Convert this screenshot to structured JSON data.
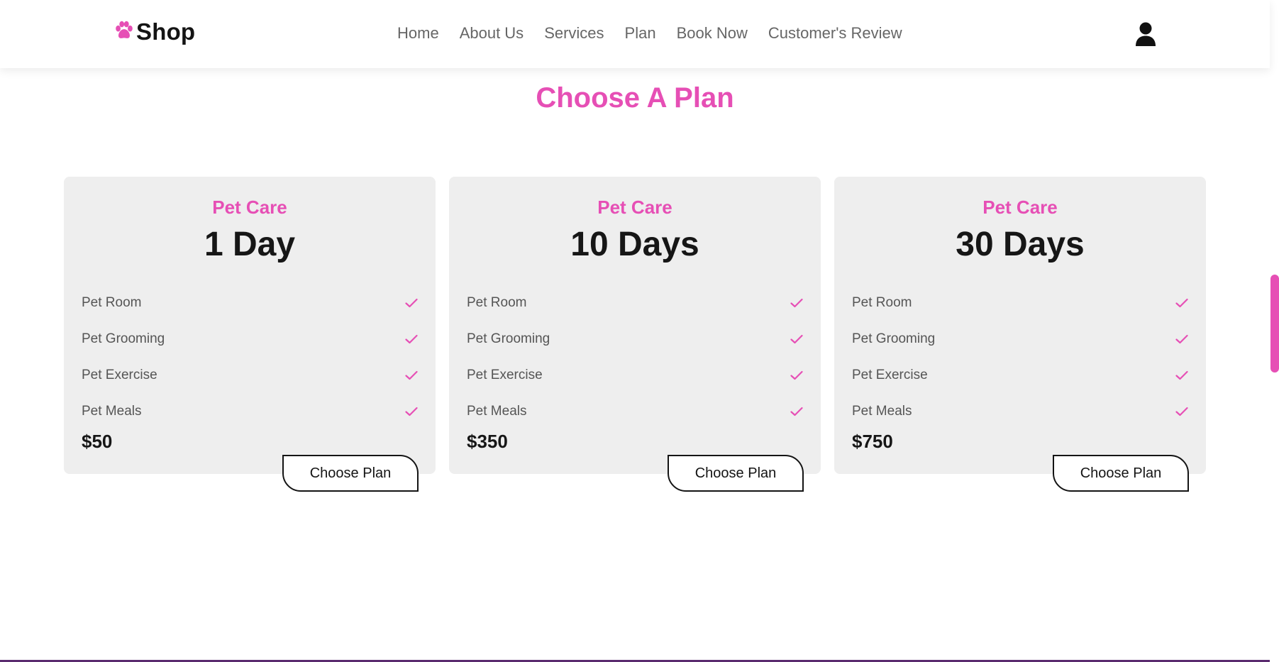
{
  "header": {
    "logo_text": "Shop",
    "logo_icon": "paw-icon",
    "nav": [
      "Home",
      "About Us",
      "Services",
      "Plan",
      "Book Now",
      "Customer's Review"
    ],
    "user_icon": "user-icon"
  },
  "section": {
    "title": "Choose A Plan"
  },
  "plans": [
    {
      "subtitle": "Pet Care",
      "title": "1 Day",
      "features": [
        "Pet Room",
        "Pet Grooming",
        "Pet Exercise",
        "Pet Meals"
      ],
      "price": "$50",
      "button": "Choose Plan"
    },
    {
      "subtitle": "Pet Care",
      "title": "10 Days",
      "features": [
        "Pet Room",
        "Pet Grooming",
        "Pet Exercise",
        "Pet Meals"
      ],
      "price": "$350",
      "button": "Choose Plan"
    },
    {
      "subtitle": "Pet Care",
      "title": "30 Days",
      "features": [
        "Pet Room",
        "Pet Grooming",
        "Pet Exercise",
        "Pet Meals"
      ],
      "price": "$750",
      "button": "Choose Plan"
    }
  ],
  "colors": {
    "accent": "#e64fb5",
    "card_bg": "#eeeeee",
    "text_dark": "#161616",
    "text_muted": "#555555"
  }
}
